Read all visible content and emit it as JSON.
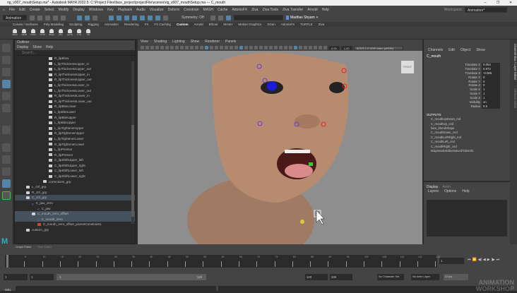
{
  "window": {
    "title": "rig_v007_mouthSetup.ma* - Autodesk MAYA 2022.5: C:\\Project Files\\face_project\\projectFile\\scenes\\rig_v007_mouthSetup.ma  ---  C_mouth",
    "minimize": "–",
    "restore": "❐",
    "close": "✕"
  },
  "menu": [
    "File",
    "Edit",
    "Create",
    "Select",
    "Modify",
    "Display",
    "Windows",
    "Key",
    "Playback",
    "Audio",
    "Visualize",
    "Deform",
    "Constrain",
    "MASH",
    "Cache",
    "AdonisFX",
    "Ziva",
    "Ziva Tools",
    "Ziva Transfer",
    "Arnold",
    "Help"
  ],
  "workspace": {
    "label": "Workspace:",
    "value": "Animation*"
  },
  "status": {
    "mode": "Animation",
    "symmetry": "Symmetry: Off",
    "user": "Madhav Shyam"
  },
  "shelf": {
    "tabs": [
      "Curves / Surfaces",
      "Poly Modeling",
      "Sculpting",
      "Rigging",
      "Animation",
      "Rendering",
      "FX",
      "FX Caching",
      "Custom",
      "Arnold",
      "Bifrost",
      "MASH",
      "Motion Graphics",
      "XGen",
      "AdonisFX",
      "TURTLE",
      "Ziva"
    ],
    "active": "Custom",
    "buttons": [
      "zMirA",
      "zMirB",
      "zTiOn",
      "zTOff",
      "zBase",
      "pTip",
      "parTip",
      "orTip",
      "CE"
    ]
  },
  "outliner": {
    "title": "Outliner",
    "menu": [
      "Display",
      "Show",
      "Help"
    ],
    "search_placeholder": "Search...",
    "items": [
      {
        "label": "R_lipBlow",
        "indent": 5,
        "type": "loc"
      },
      {
        "label": "L_lipThicknessUpper_in",
        "indent": 5,
        "type": "loc"
      },
      {
        "label": "L_lipThicknessUpper_out",
        "indent": 5,
        "type": "loc"
      },
      {
        "label": "R_lipThicknessUpper_in",
        "indent": 5,
        "type": "loc"
      },
      {
        "label": "R_lipThicknessUpper_out",
        "indent": 5,
        "type": "loc"
      },
      {
        "label": "L_lipThicknessLower_in",
        "indent": 5,
        "type": "loc"
      },
      {
        "label": "L_lipThicknessLower_out",
        "indent": 5,
        "type": "loc"
      },
      {
        "label": "R_lipThicknessLower_in",
        "indent": 5,
        "type": "loc"
      },
      {
        "label": "R_lipThicknessLower_out",
        "indent": 5,
        "type": "loc"
      },
      {
        "label": "R_lipBiteLower",
        "indent": 5,
        "type": "loc"
      },
      {
        "label": "L_lipBiteLower",
        "indent": 5,
        "type": "loc"
      },
      {
        "label": "R_lipBiteUpper",
        "indent": 5,
        "type": "loc"
      },
      {
        "label": "L_lipBiteUpper",
        "indent": 5,
        "type": "loc"
      },
      {
        "label": "L_lipTightenerUpper",
        "indent": 5,
        "type": "loc"
      },
      {
        "label": "R_lipTightenerUpper",
        "indent": 5,
        "type": "loc"
      },
      {
        "label": "L_lipTightenerLower",
        "indent": 5,
        "type": "loc"
      },
      {
        "label": "R_lipTightenerLower",
        "indent": 5,
        "type": "loc"
      },
      {
        "label": "L_lipPressor",
        "indent": 5,
        "type": "loc"
      },
      {
        "label": "R_lipPressor",
        "indent": 5,
        "type": "loc"
      },
      {
        "label": "C_lipShiftUpper_left",
        "indent": 5,
        "type": "loc"
      },
      {
        "label": "C_lipShiftUpper_right",
        "indent": 5,
        "type": "loc"
      },
      {
        "label": "C_lipShiftLower_left",
        "indent": 5,
        "type": "loc"
      },
      {
        "label": "C_lipShiftLower_right",
        "indent": 5,
        "type": "loc"
      },
      {
        "label": "correctives_grp",
        "indent": 4,
        "type": "grp"
      },
      {
        "label": "L_ctrl_grp",
        "indent": 1,
        "type": "grp"
      },
      {
        "label": "R_ctrl_grp",
        "indent": 1,
        "type": "grp"
      },
      {
        "label": "C_ctrl_grp",
        "indent": 1,
        "type": "grp",
        "state": "sel"
      },
      {
        "label": "C_jaw_zero",
        "indent": 2,
        "type": "joint"
      },
      {
        "label": "C_jaw",
        "indent": 3,
        "type": "joint"
      },
      {
        "label": "C_mouth_zero_offset",
        "indent": 2,
        "type": "grp",
        "state": "hl"
      },
      {
        "label": "C_mouth_zero",
        "indent": 3,
        "type": "joint",
        "state": "hl"
      },
      {
        "label": "C_mouth_zero_offset_parentConstraint1",
        "indent": 3,
        "type": "constraint"
      },
      {
        "label": "custom_grp",
        "indent": 1,
        "type": "grp"
      }
    ]
  },
  "viewport": {
    "menu": [
      "View",
      "Shading",
      "Lighting",
      "Show",
      "Renderer",
      "Panels"
    ],
    "exposure": "0.00",
    "gamma": "1.00",
    "color_space": "ACES 1.0 SDR-video (sRGB)",
    "view_cube": "FRONT"
  },
  "channel_box": {
    "menu": [
      "Channels",
      "Edit",
      "Object",
      "Show"
    ],
    "object": "C_mouth",
    "attributes": [
      {
        "name": "Translate X",
        "value": "0.064"
      },
      {
        "name": "Translate Y",
        "value": "0.972"
      },
      {
        "name": "Translate Z",
        "value": "-0.065"
      },
      {
        "name": "Rotate X",
        "value": "0"
      },
      {
        "name": "Rotate Y",
        "value": "0"
      },
      {
        "name": "Rotate Z",
        "value": "0"
      },
      {
        "name": "Scale X",
        "value": "1"
      },
      {
        "name": "Scale Y",
        "value": "1"
      },
      {
        "name": "Scale Z",
        "value": "1"
      },
      {
        "name": "Visibility",
        "value": "on"
      },
      {
        "name": "Radius",
        "value": "0.5"
      }
    ],
    "outputs_label": "OUTPUTS",
    "outputs": [
      "C_mouthUpDown_md",
      "C_mouthUp_cnd",
      "face_blendShape",
      "C_mouthDown_cnd",
      "C_mouthLeftRight_md",
      "C_mouthLeft_cnd",
      "C_mouthRight_cnd",
      "MayaNodeEditorSavedTabsInfo"
    ]
  },
  "layer_editor": {
    "tabs": [
      "Display",
      "Anim"
    ],
    "menu": [
      "Layers",
      "Options",
      "Help"
    ]
  },
  "side_tabs": [
    "Channel Box / Layer Editor",
    "Attribute Editor"
  ],
  "bottom_tabs": [
    "Graph Editor",
    "Time Editor"
  ],
  "timeline": {
    "ticks": [
      "1",
      "5",
      "10",
      "15",
      "20",
      "25",
      "30",
      "35",
      "40",
      "45",
      "50",
      "55",
      "60",
      "65",
      "70",
      "75",
      "80",
      "85",
      "90",
      "95",
      "100",
      "105",
      "110",
      "115",
      "120"
    ],
    "current_frame": "1"
  },
  "range": {
    "start": "1",
    "playback_start": "1",
    "slider_start": "1",
    "slider_end": "120",
    "playback_end": "120",
    "end": "200",
    "character_set": "No Character Set",
    "anim_layer": "No Anim Layer",
    "fps": "24 fps"
  },
  "command_line": {
    "label": "MEL"
  },
  "watermark": "ANIMATION WORKSHOP"
}
